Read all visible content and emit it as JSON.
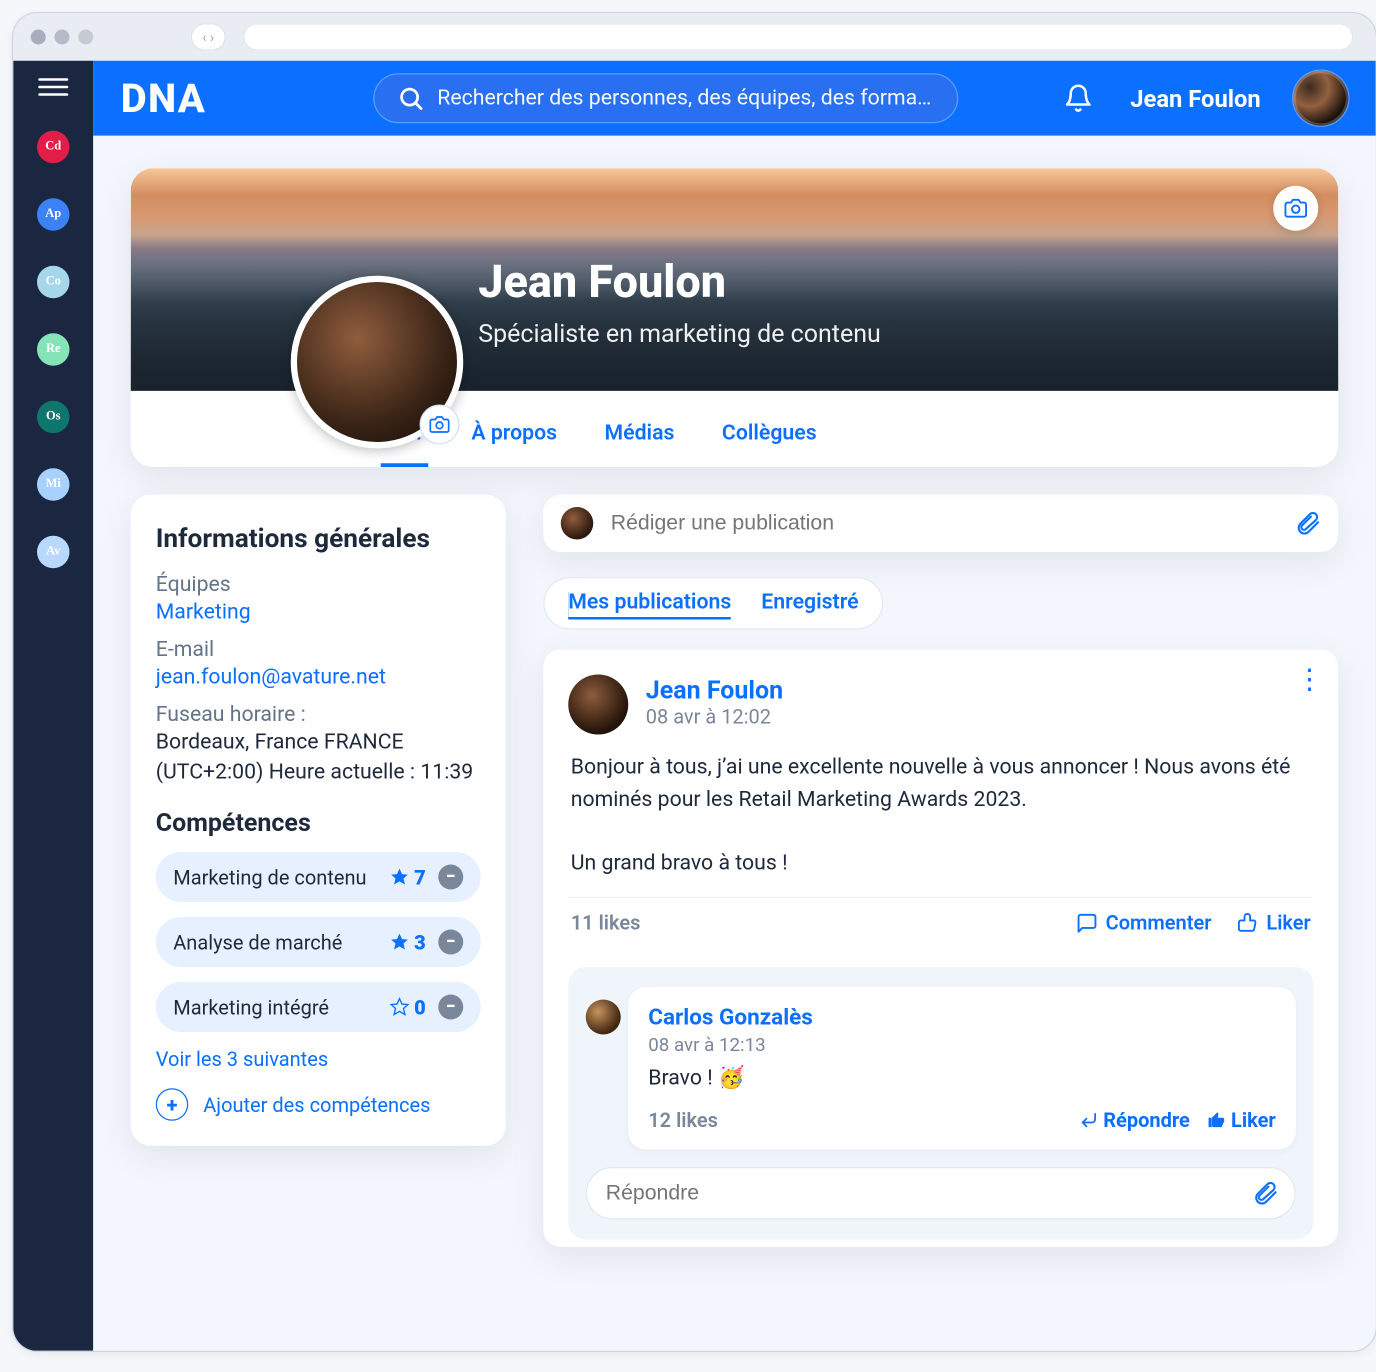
{
  "header": {
    "logo": "DNA",
    "search_placeholder": "Rechercher des personnes, des équipes, des forma…",
    "username": "Jean Foulon"
  },
  "leftchips": [
    {
      "label": "Cd",
      "color": "#e11d48"
    },
    {
      "label": "Ap",
      "color": "#3b82f6"
    },
    {
      "label": "Co",
      "color": "#a5d6ea"
    },
    {
      "label": "Re",
      "color": "#86e3b8"
    },
    {
      "label": "Os",
      "color": "#0f766e"
    },
    {
      "label": "Mi",
      "color": "#a9d1ff"
    },
    {
      "label": "Av",
      "color": "#b9d8ff"
    }
  ],
  "profile": {
    "name": "Jean Foulon",
    "role": "Spécialiste en marketing de contenu",
    "tabs": [
      "Mur",
      "À propos",
      "Médias",
      "Collègues"
    ],
    "active_tab_index": 0
  },
  "general": {
    "title": "Informations générales",
    "teams_label": "Équipes",
    "teams_value": "Marketing",
    "email_label": "E-mail",
    "email_value": "jean.foulon@avature.net",
    "tz_label": "Fuseau horaire :",
    "tz_line1": "Bordeaux, France FRANCE",
    "tz_line2": "(UTC+2:00) Heure actuelle : 11:39"
  },
  "skills": {
    "title": "Compétences",
    "items": [
      {
        "name": "Marketing de contenu",
        "count": 7,
        "filled": true
      },
      {
        "name": "Analyse de marché",
        "count": 3,
        "filled": true
      },
      {
        "name": "Marketing intégré",
        "count": 0,
        "filled": false
      }
    ],
    "see_more": "Voir les 3 suivantes",
    "add": "Ajouter des compétences"
  },
  "composer": {
    "placeholder": "Rédiger une publication"
  },
  "post_tabs": {
    "items": [
      "Mes publications",
      "Enregistré"
    ],
    "active": 0
  },
  "post": {
    "author": "Jean Foulon",
    "time": "08 avr à 12:02",
    "text": "Bonjour à tous, j’ai une excellente nouvelle à vous annoncer ! Nous avons été nominés pour les Retail Marketing Awards 2023.",
    "text2": "Un grand bravo à tous !",
    "likes": "11 likes",
    "action_comment": "Commenter",
    "action_like": "Liker",
    "reply": {
      "author": "Carlos Gonzalès",
      "time": "08 avr à 12:13",
      "text": "Bravo ! 🥳",
      "likes": "12 likes",
      "action_reply": "Répondre",
      "action_like": "Liker"
    },
    "reply_placeholder": "Répondre"
  }
}
